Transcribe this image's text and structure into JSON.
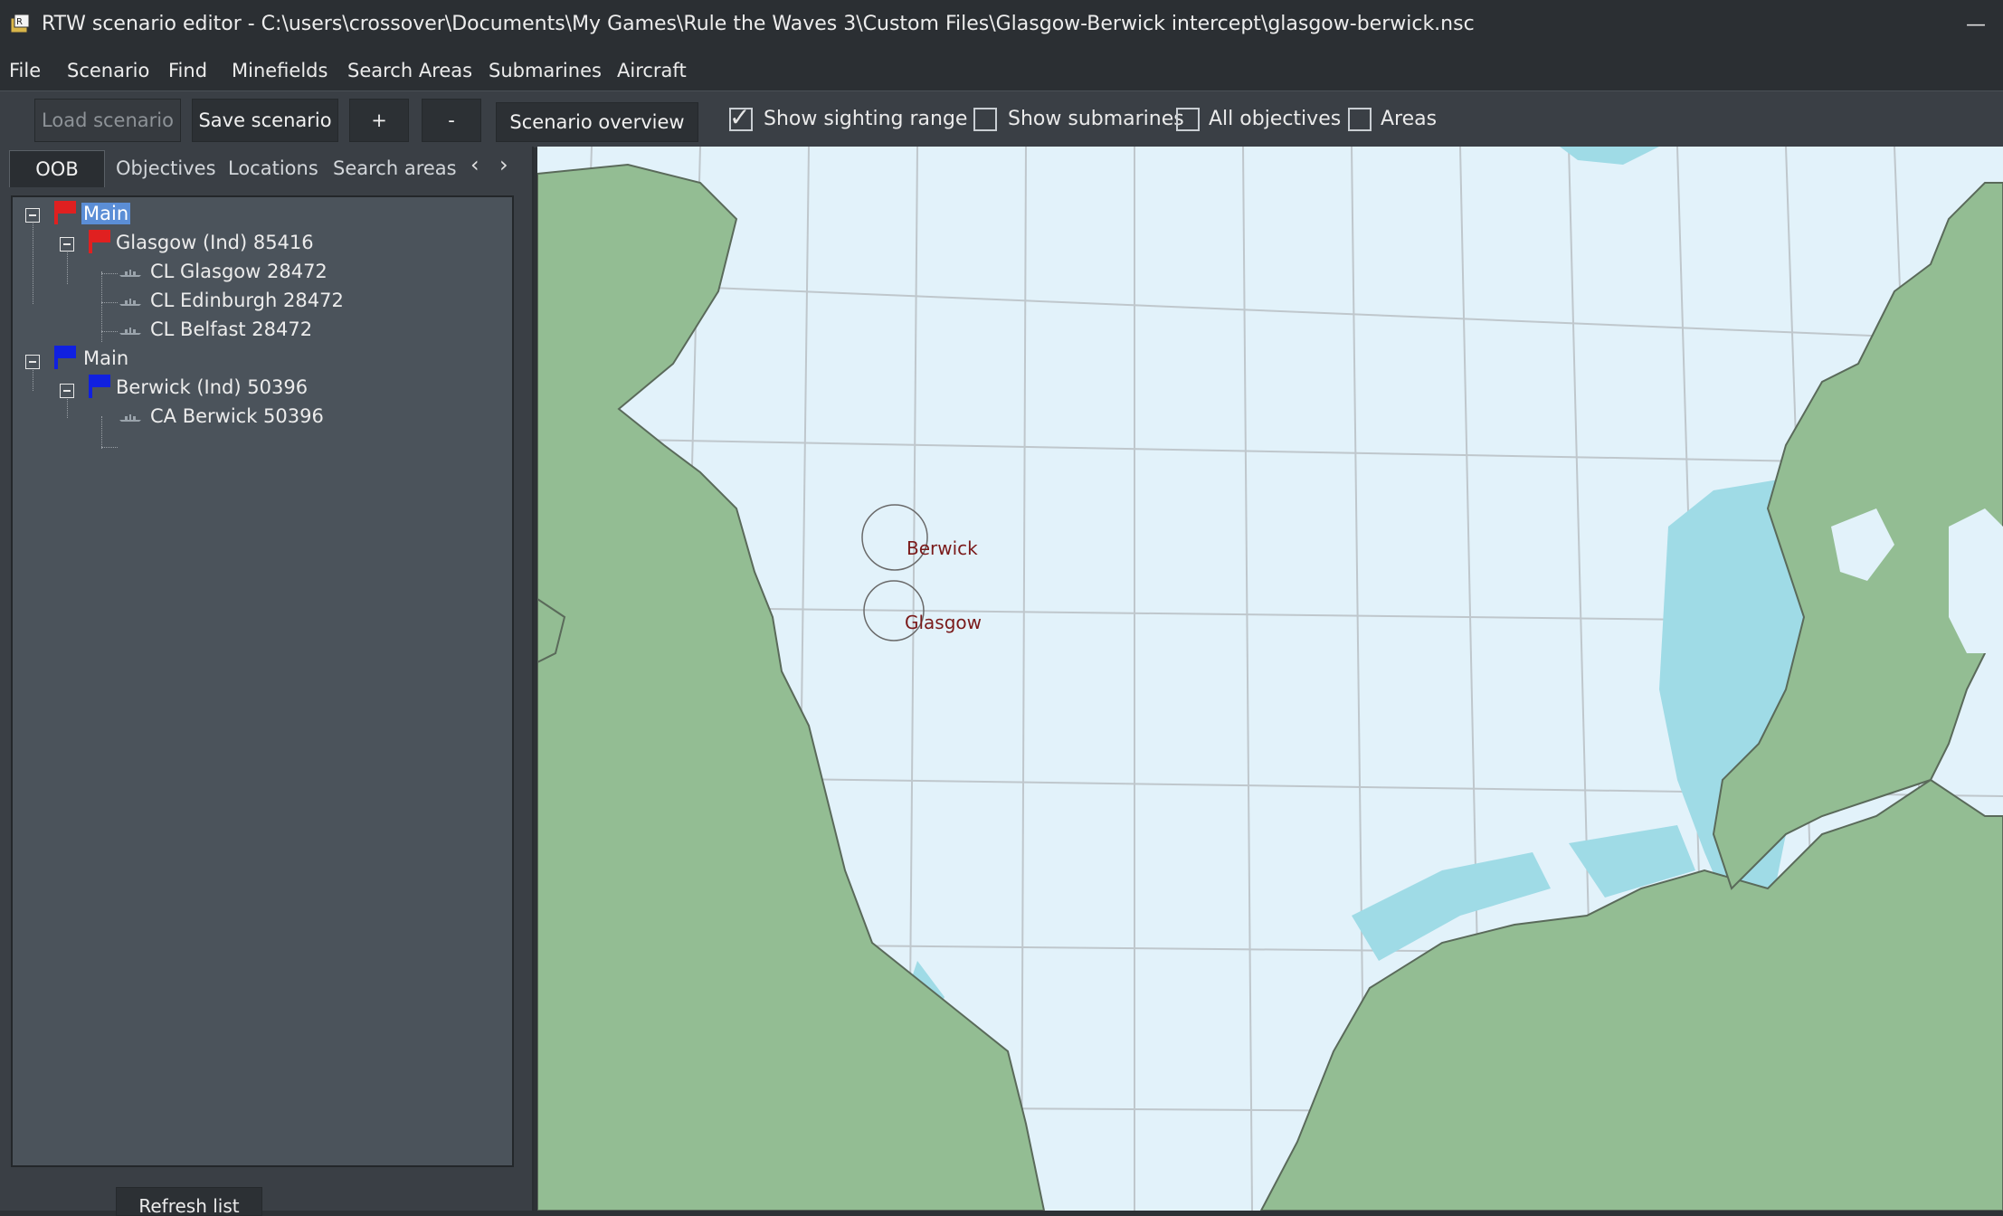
{
  "window": {
    "title": "RTW scenario editor - C:\\users\\crossover\\Documents\\My Games\\Rule the Waves 3\\Custom Files\\Glasgow-Berwick intercept\\glasgow-berwick.nsc",
    "minimize": "—"
  },
  "menu": [
    "File",
    "Scenario",
    "Find",
    "Minefields",
    "Search Areas",
    "Submarines",
    "Aircraft"
  ],
  "toolbar": {
    "load": "Load scenario",
    "save": "Save scenario",
    "plus": "+",
    "minus": "-",
    "overview": "Scenario overview",
    "checks": [
      {
        "label": "Show sighting range",
        "checked": true
      },
      {
        "label": "Show submarines",
        "checked": false
      },
      {
        "label": "All objectives",
        "checked": false
      },
      {
        "label": "Areas",
        "checked": false
      }
    ]
  },
  "tabs": [
    "OOB",
    "Objectives",
    "Locations",
    "Search areas"
  ],
  "tree": [
    {
      "label": "Main",
      "selected": true,
      "flag": "#e02020"
    },
    {
      "label": "Glasgow (Ind) 85416",
      "flag": "#e02020"
    },
    {
      "label": "CL Glasgow 28472"
    },
    {
      "label": "CL Edinburgh 28472"
    },
    {
      "label": "CL Belfast 28472"
    },
    {
      "label": "Main",
      "flag": "#1020e0"
    },
    {
      "label": "Berwick (Ind) 50396",
      "flag": "#1020e0"
    },
    {
      "label": "CA Berwick 50396"
    }
  ],
  "refresh_label": "Refresh list",
  "map": {
    "labels": [
      "Berwick",
      "Glasgow"
    ],
    "colors": {
      "sea": "#e2f2fa",
      "land": "#93bd93",
      "shallow": "#9fdbe6",
      "grid": "#bfc7cc"
    }
  },
  "icons": {
    "app": "app-icon",
    "expand": "tree-collapse-icon",
    "flag": "flag-icon",
    "ship": "ship-icon"
  }
}
